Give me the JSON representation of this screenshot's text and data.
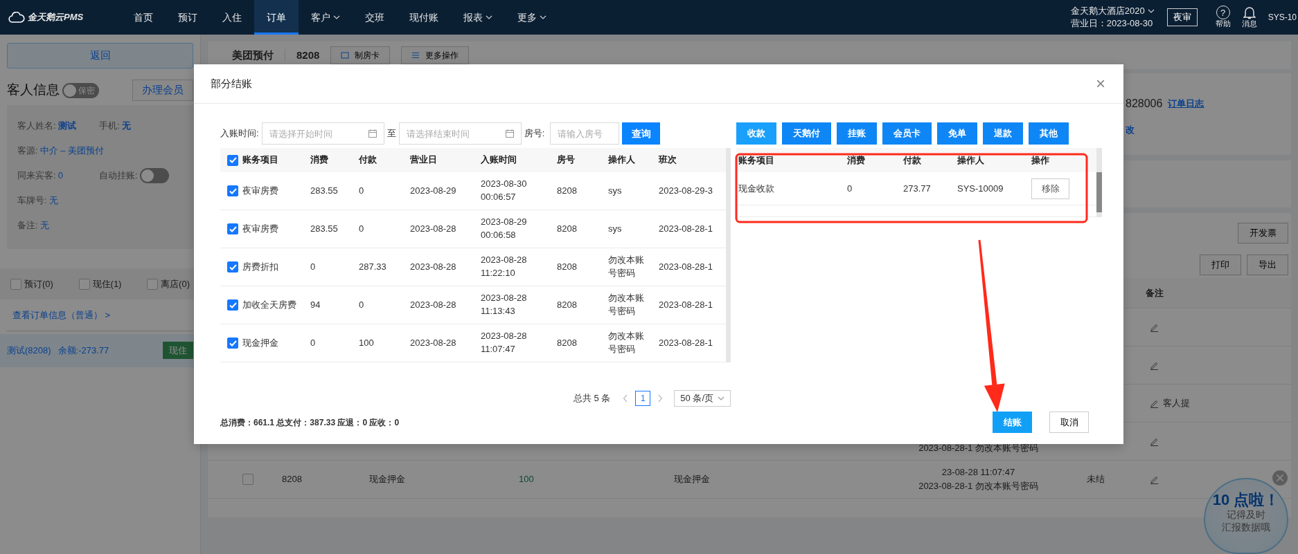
{
  "nav": {
    "logo": "金天鹅云PMS",
    "items": [
      {
        "label": "首页",
        "selected": false,
        "dropdown": false
      },
      {
        "label": "预订",
        "selected": false,
        "dropdown": false
      },
      {
        "label": "入住",
        "selected": false,
        "dropdown": false
      },
      {
        "label": "订单",
        "selected": true,
        "dropdown": false
      },
      {
        "label": "客户",
        "selected": false,
        "dropdown": true
      },
      {
        "label": "交班",
        "selected": false,
        "dropdown": false
      },
      {
        "label": "现付账",
        "selected": false,
        "dropdown": false
      },
      {
        "label": "报表",
        "selected": false,
        "dropdown": true
      },
      {
        "label": "更多",
        "selected": false,
        "dropdown": true
      }
    ],
    "hotel": "金天鹅大酒店2020",
    "business_day": "营业日：2023-08-30",
    "night_audit": "夜审",
    "help_icon": "?",
    "help": "帮助",
    "messages": "消息",
    "user": "SYS-10"
  },
  "sidebar": {
    "back": "返回",
    "title": "客人信息",
    "privacy": {
      "label": "保密",
      "on": false
    },
    "member_button": "办理会员",
    "info_rows": [
      [
        {
          "kind": "text",
          "label": "客人姓名:",
          "value": "测试",
          "bold": true
        },
        {
          "kind": "text",
          "label": "手机:",
          "value": "无",
          "bold": true
        }
      ],
      [
        {
          "kind": "text",
          "label": "客源:",
          "value": "中介  – 美团预付",
          "bold": false
        }
      ],
      [
        {
          "kind": "text",
          "label": "同来宾客:",
          "value": "0",
          "bold": false
        },
        {
          "kind": "toggle",
          "label": "自动挂账:",
          "on": false
        }
      ],
      [
        {
          "kind": "text",
          "label": "车牌号:",
          "value": "无",
          "bold": false
        }
      ],
      [
        {
          "kind": "text",
          "label": "备注:",
          "value": "无",
          "bold": false
        }
      ]
    ],
    "filters": [
      {
        "label": "预订(0)",
        "checked": false
      },
      {
        "label": "现住(1)",
        "checked": false
      },
      {
        "label": "离店(0)",
        "checked": false
      }
    ],
    "order_link": "查看订单信息（普通） >",
    "orders": [
      {
        "name": "测试(8208)",
        "balance": "余额:-273.77",
        "status": "现住",
        "selected": true
      }
    ]
  },
  "main": {
    "channel": "美团预付",
    "room": "8208",
    "actions": [
      "制房卡",
      "更多操作"
    ],
    "order_number": "828006",
    "order_log": "订单日志",
    "edit": "改",
    "invoice": "开发票",
    "print": "打印",
    "export": "导出",
    "remark_header": "备注",
    "rows": [
      {
        "editable": true
      },
      {
        "editable": true
      },
      {
        "editable": true,
        "remark": "客人提"
      },
      {
        "editable": true,
        "date_lines": [
          "2023-08-28-1 勿改本账号密码"
        ]
      },
      {
        "checked": false,
        "room": "8208",
        "item": "现金押金",
        "amount": "100",
        "item_2": "现金押金",
        "date_lines": [
          "23-08-28 11:07:47",
          "2023-08-28-1 勿改本账号密码"
        ],
        "status": "未结",
        "editable": true
      }
    ]
  },
  "widget": {
    "title": "10 点啦！",
    "lines": [
      "记得及时",
      "汇报数据哦"
    ]
  },
  "modal": {
    "title": "部分结账",
    "close": "×",
    "filters": {
      "time_label": "入账时间:",
      "start_placeholder": "请选择开始时间",
      "to": "至",
      "end_placeholder": "请选择结束时间",
      "room_label": "房号:",
      "room_placeholder": "请输入房号",
      "query": "查询"
    },
    "bills": {
      "all_checked": true,
      "columns": [
        "账务项目",
        "消费",
        "付款",
        "营业日",
        "入账时间",
        "房号",
        "操作人",
        "班次"
      ],
      "rows": [
        {
          "checked": true,
          "cells": [
            "夜审房费",
            "283.55",
            "0",
            "2023-08-29",
            "2023-08-30 00:06:57",
            "8208",
            "sys",
            "2023-08-29-3"
          ]
        },
        {
          "checked": true,
          "cells": [
            "夜审房费",
            "283.55",
            "0",
            "2023-08-28",
            "2023-08-29 00:06:58",
            "8208",
            "sys",
            "2023-08-28-1"
          ]
        },
        {
          "checked": true,
          "cells": [
            "房费折扣",
            "0",
            "287.33",
            "2023-08-28",
            "2023-08-28 11:22:10",
            "8208",
            "勿改本账号密码",
            "2023-08-28-1"
          ]
        },
        {
          "checked": true,
          "cells": [
            "加收全天房费",
            "94",
            "0",
            "2023-08-28",
            "2023-08-28 11:13:43",
            "8208",
            "勿改本账号密码",
            "2023-08-28-1"
          ]
        },
        {
          "checked": true,
          "cells": [
            "现金押金",
            "0",
            "100",
            "2023-08-28",
            "2023-08-28 11:07:47",
            "8208",
            "勿改本账号密码",
            "2023-08-28-1"
          ]
        }
      ]
    },
    "pay_buttons": [
      {
        "label": "收款",
        "selected": true
      },
      {
        "label": "天鹅付",
        "selected": false
      },
      {
        "label": "挂账",
        "selected": false
      },
      {
        "label": "会员卡",
        "selected": false
      },
      {
        "label": "免单",
        "selected": false
      },
      {
        "label": "退款",
        "selected": false
      },
      {
        "label": "其他",
        "selected": false
      }
    ],
    "payments": {
      "columns": [
        "账务项目",
        "消费",
        "付款",
        "操作人",
        "操作"
      ],
      "rows": [
        {
          "cells": [
            "现金收款",
            "0",
            "273.77",
            "SYS-10009"
          ],
          "action": "移除"
        }
      ]
    },
    "pagination": {
      "total": "总共 5 条",
      "pages": [
        {
          "label": "1",
          "selected": true
        }
      ],
      "page_size": "50 条/页"
    },
    "summary": "总消费：661.1  总支付：387.33  应退：0  应收：0",
    "confirm": "结账",
    "cancel": "取消"
  }
}
